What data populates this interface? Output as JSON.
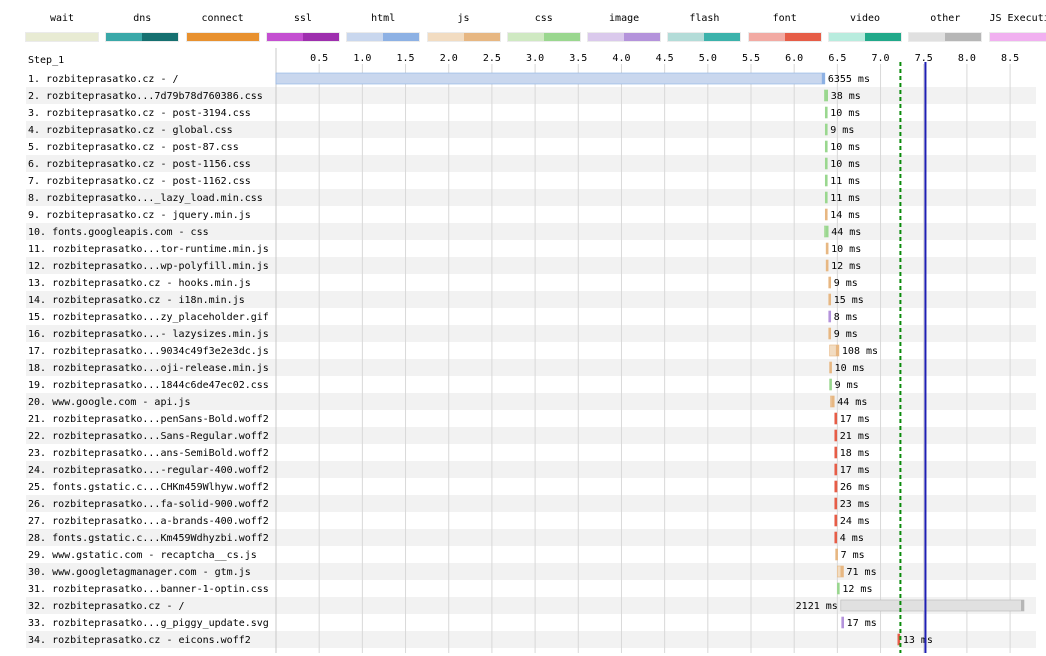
{
  "step_label": "Step_1",
  "legend": [
    {
      "label": "wait",
      "colors": [
        "#e8ebd3",
        "#e8ebd3"
      ]
    },
    {
      "label": "dns",
      "colors": [
        "#3aa8a8",
        "#157070"
      ]
    },
    {
      "label": "connect",
      "colors": [
        "#e8912f",
        "#e8912f"
      ]
    },
    {
      "label": "ssl",
      "colors": [
        "#c44fd1",
        "#9e2fae"
      ]
    },
    {
      "label": "html",
      "colors": [
        "#c9d7ee",
        "#8db1e4"
      ]
    },
    {
      "label": "js",
      "colors": [
        "#f2dcc1",
        "#e7b782"
      ]
    },
    {
      "label": "css",
      "colors": [
        "#cfe9c2",
        "#9ad78f"
      ]
    },
    {
      "label": "image",
      "colors": [
        "#dac9ec",
        "#b493db"
      ]
    },
    {
      "label": "flash",
      "colors": [
        "#b3dcd8",
        "#3bb2ab"
      ]
    },
    {
      "label": "font",
      "colors": [
        "#f2aaa3",
        "#e65d47"
      ]
    },
    {
      "label": "video",
      "colors": [
        "#b8ecde",
        "#21a98a"
      ]
    },
    {
      "label": "other",
      "colors": [
        "#e0e0e0",
        "#b6b6b6"
      ]
    },
    {
      "label": "JS Execution",
      "colors": [
        "#f1b0f0",
        "#f1b0f0"
      ]
    }
  ],
  "chart_data": {
    "type": "table",
    "xlim": [
      0,
      8.8
    ],
    "ticks": [
      "0.5",
      "1.0",
      "1.5",
      "2.0",
      "2.5",
      "3.0",
      "3.5",
      "4.0",
      "4.5",
      "5.0",
      "5.5",
      "6.0",
      "6.5",
      "7.0",
      "7.5",
      "8.0",
      "8.5"
    ],
    "markers": [
      {
        "time": 7.23,
        "color": "#0a8a0a",
        "style": "dashed"
      },
      {
        "time": 7.52,
        "color": "#1f1fb4",
        "style": "solid"
      }
    ],
    "requests": [
      {
        "label": "1. rozbiteprasatko.cz - /",
        "start": 0.0,
        "duration_ms": 6355,
        "duration": "6355 ms",
        "type": "html"
      },
      {
        "label": "2. rozbiteprasatko...7d79b78d760386.css",
        "start": 6.35,
        "duration_ms": 38,
        "duration": "38 ms",
        "type": "css"
      },
      {
        "label": "3. rozbiteprasatko.cz - post-3194.css",
        "start": 6.36,
        "duration_ms": 10,
        "duration": "10 ms",
        "type": "css"
      },
      {
        "label": "4. rozbiteprasatko.cz - global.css",
        "start": 6.36,
        "duration_ms": 9,
        "duration": "9 ms",
        "type": "css"
      },
      {
        "label": "5. rozbiteprasatko.cz - post-87.css",
        "start": 6.36,
        "duration_ms": 10,
        "duration": "10 ms",
        "type": "css"
      },
      {
        "label": "6. rozbiteprasatko.cz - post-1156.css",
        "start": 6.36,
        "duration_ms": 10,
        "duration": "10 ms",
        "type": "css"
      },
      {
        "label": "7. rozbiteprasatko.cz - post-1162.css",
        "start": 6.36,
        "duration_ms": 11,
        "duration": "11 ms",
        "type": "css"
      },
      {
        "label": "8. rozbiteprasatko..._lazy_load.min.css",
        "start": 6.36,
        "duration_ms": 11,
        "duration": "11 ms",
        "type": "css"
      },
      {
        "label": "9. rozbiteprasatko.cz - jquery.min.js",
        "start": 6.36,
        "duration_ms": 14,
        "duration": "14 ms",
        "type": "js"
      },
      {
        "label": "10. fonts.googleapis.com - css",
        "start": 6.35,
        "duration_ms": 44,
        "duration": "44 ms",
        "type": "css"
      },
      {
        "label": "11. rozbiteprasatko...tor-runtime.min.js",
        "start": 6.37,
        "duration_ms": 10,
        "duration": "10 ms",
        "type": "js"
      },
      {
        "label": "12. rozbiteprasatko...wp-polyfill.min.js",
        "start": 6.37,
        "duration_ms": 12,
        "duration": "12 ms",
        "type": "js"
      },
      {
        "label": "13. rozbiteprasatko.cz - hooks.min.js",
        "start": 6.4,
        "duration_ms": 9,
        "duration": "9 ms",
        "type": "js"
      },
      {
        "label": "14. rozbiteprasatko.cz - i18n.min.js",
        "start": 6.4,
        "duration_ms": 15,
        "duration": "15 ms",
        "type": "js"
      },
      {
        "label": "15. rozbiteprasatko...zy_placeholder.gif",
        "start": 6.4,
        "duration_ms": 8,
        "duration": "8 ms",
        "type": "image"
      },
      {
        "label": "16. rozbiteprasatko...- lazysizes.min.js",
        "start": 6.4,
        "duration_ms": 9,
        "duration": "9 ms",
        "type": "js"
      },
      {
        "label": "17. rozbiteprasatko...9034c49f3e2e3dc.js",
        "start": 6.41,
        "duration_ms": 108,
        "duration": "108 ms",
        "type": "js"
      },
      {
        "label": "18. rozbiteprasatko...oji-release.min.js",
        "start": 6.41,
        "duration_ms": 10,
        "duration": "10 ms",
        "type": "js"
      },
      {
        "label": "19. rozbiteprasatko...1844c6de47ec02.css",
        "start": 6.41,
        "duration_ms": 9,
        "duration": "9 ms",
        "type": "css"
      },
      {
        "label": "20. www.google.com - api.js",
        "start": 6.42,
        "duration_ms": 44,
        "duration": "44 ms",
        "type": "js"
      },
      {
        "label": "21. rozbiteprasatko...penSans-Bold.woff2",
        "start": 6.47,
        "duration_ms": 17,
        "duration": "17 ms",
        "type": "font"
      },
      {
        "label": "22. rozbiteprasatko...Sans-Regular.woff2",
        "start": 6.47,
        "duration_ms": 21,
        "duration": "21 ms",
        "type": "font"
      },
      {
        "label": "23. rozbiteprasatko...ans-SemiBold.woff2",
        "start": 6.47,
        "duration_ms": 18,
        "duration": "18 ms",
        "type": "font"
      },
      {
        "label": "24. rozbiteprasatko...-regular-400.woff2",
        "start": 6.47,
        "duration_ms": 17,
        "duration": "17 ms",
        "type": "font"
      },
      {
        "label": "25. fonts.gstatic.c...CHKm459Wlhyw.woff2",
        "start": 6.47,
        "duration_ms": 26,
        "duration": "26 ms",
        "type": "font"
      },
      {
        "label": "26. rozbiteprasatko...fa-solid-900.woff2",
        "start": 6.47,
        "duration_ms": 23,
        "duration": "23 ms",
        "type": "font"
      },
      {
        "label": "27. rozbiteprasatko...a-brands-400.woff2",
        "start": 6.47,
        "duration_ms": 24,
        "duration": "24 ms",
        "type": "font"
      },
      {
        "label": "28. fonts.gstatic.c...Km459Wdhyzbi.woff2",
        "start": 6.47,
        "duration_ms": 4,
        "duration": "4 ms",
        "type": "font"
      },
      {
        "label": "29. www.gstatic.com - recaptcha__cs.js",
        "start": 6.48,
        "duration_ms": 7,
        "duration": "7 ms",
        "type": "js"
      },
      {
        "label": "30. www.googletagmanager.com - gtm.js",
        "start": 6.5,
        "duration_ms": 71,
        "duration": "71 ms",
        "type": "js"
      },
      {
        "label": "31. rozbiteprasatko...banner-1-optin.css",
        "start": 6.5,
        "duration_ms": 12,
        "duration": "12 ms",
        "type": "css"
      },
      {
        "label": "32. rozbiteprasatko.cz - /",
        "start": 6.54,
        "duration_ms": 2121,
        "duration": "2121 ms",
        "type": "other"
      },
      {
        "label": "33. rozbiteprasatko...g_piggy_update.svg",
        "start": 6.55,
        "duration_ms": 17,
        "duration": "17 ms",
        "type": "image"
      },
      {
        "label": "34. rozbiteprasatko.cz - eicons.woff2",
        "start": 7.2,
        "duration_ms": 13,
        "duration": "13 ms",
        "type": "font"
      }
    ]
  }
}
